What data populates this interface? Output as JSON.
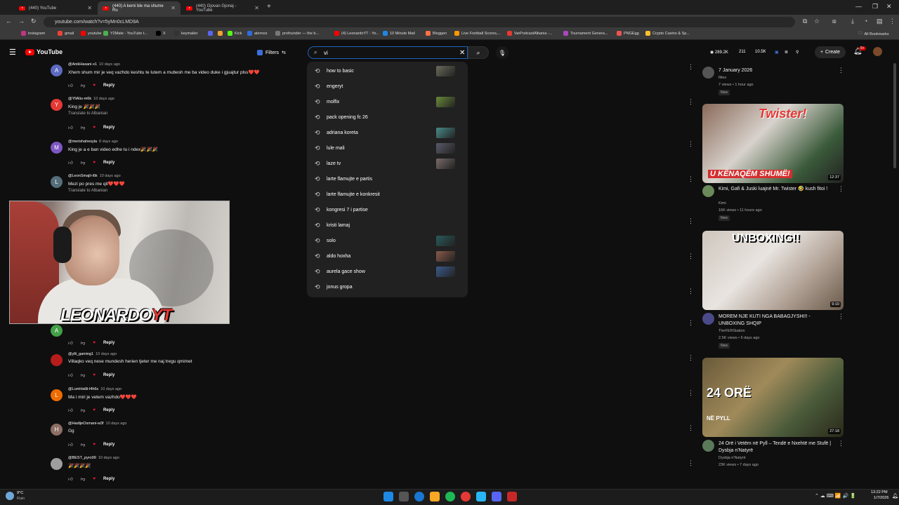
{
  "browser": {
    "tabs": [
      {
        "label": "(440) YouTube",
        "active": false
      },
      {
        "label": "(440) A kemi ble ma shume Ru",
        "active": true
      },
      {
        "label": "(440) Gjovan Gjonaj - YouTube",
        "active": false
      }
    ],
    "new_tab": "+",
    "url": "youtube.com/watch?v=5yMn0cLMD9A",
    "bookmarks": [
      "instagram",
      "gmail",
      "youtube",
      "Y2Mate - YouTube t...",
      "X",
      "keymailer",
      "",
      "",
      "Kick",
      "aternos",
      "profounder — the b...",
      "(4) LeonardoYT - Yo...",
      "10 Minute Mail",
      "Bloggen",
      "Live Football Scores,...",
      "VarPodcastAlbania -...",
      "Tournament Genera...",
      "PNGEgg",
      "Crypto Casino & Sp..."
    ],
    "all_bookmarks": "All Bookmarks"
  },
  "youtube": {
    "logo_text": "YouTube",
    "filters_label": "Filters",
    "search_value": "vi",
    "stats": [
      "289.2K",
      "211",
      "10.5K"
    ],
    "create_label": "Create",
    "notif_count": "9+"
  },
  "suggestions": [
    {
      "text": "how to basic",
      "thumb": "#6a6a5a"
    },
    {
      "text": "engeryt",
      "thumb": ""
    },
    {
      "text": "molfix",
      "thumb": "#6a8a3a"
    },
    {
      "text": "pack opening fc 26",
      "thumb": ""
    },
    {
      "text": "adriana koreta",
      "thumb": "#4a8a8a"
    },
    {
      "text": "lule mali",
      "thumb": "#5a5a6a"
    },
    {
      "text": "laze tv",
      "thumb": "#7a6a6a"
    },
    {
      "text": "larte flamujte e partis",
      "thumb": ""
    },
    {
      "text": "larte flamujte e konkresit",
      "thumb": ""
    },
    {
      "text": "kongresi 7 i partise",
      "thumb": ""
    },
    {
      "text": "kristi lamaj",
      "thumb": ""
    },
    {
      "text": "solo",
      "thumb": "#2a5a5a"
    },
    {
      "text": "aldo hoxha",
      "thumb": "#8a5a4a"
    },
    {
      "text": "aurela gace show",
      "thumb": "#3a5a8a"
    },
    {
      "text": "jonus gropa",
      "thumb": ""
    }
  ],
  "comments": [
    {
      "initial": "A",
      "color": "#5c6bc0",
      "user": "@AnikHasani-x1",
      "time": "10 days ago",
      "text": "Xhem shum mir je veq vazhdo keshtu te lutem a mubesh me ba video duke i gjuajtur plss❤️❤️",
      "translate": "",
      "reply": "Reply"
    },
    {
      "initial": "Y",
      "color": "#e53935",
      "user": "@YllAliu-m6k",
      "time": "10 days ago",
      "text": "King je 🎉🎉🎉",
      "translate": "Translate to Albanian",
      "reply": "Reply"
    },
    {
      "initial": "M",
      "color": "#7e57c2",
      "user": "@merishahesyla",
      "time": "8 days ago",
      "text": "King je a e ban video edhe tu i ndex🎉🎉🎉",
      "translate": "",
      "reply": "Reply"
    },
    {
      "initial": "L",
      "color": "#546e7a",
      "user": "@LeonSmajli-i6k",
      "time": "10 days ago",
      "text": "Mezi po pres me qit❤️❤️❤️",
      "translate": "Translate to Albanian",
      "reply": ""
    },
    {
      "initial": "A",
      "color": "#43a047",
      "user": "",
      "time": "",
      "text": "",
      "translate": "",
      "reply": "Reply"
    },
    {
      "initial": "",
      "color": "#b71c1c",
      "user": "@ylli_gaming1",
      "time": "10 days ago",
      "text": "Villaqko veq nese mundesh herien tjeter me naj tregu qmimet",
      "translate": "",
      "reply": "Reply"
    },
    {
      "initial": "L",
      "color": "#ef6c00",
      "user": "@LumHalili-l4h6s",
      "time": "10 days ago",
      "text": "Ma i miri je vetem vazhdo❤️❤️❤️",
      "translate": "",
      "reply": "Reply"
    },
    {
      "initial": "H",
      "color": "#8d6e63",
      "user": "@HadijeOsmani-w3f",
      "time": "10 days ago",
      "text": "Gg",
      "translate": "",
      "reply": "Reply"
    },
    {
      "initial": "",
      "color": "#9e9e9e",
      "user": "@BEST_pyro99",
      "time": "10 days ago",
      "text": "🎉🎉🎉🎉",
      "translate": "",
      "reply": "Reply"
    }
  ],
  "sidebar": [
    {
      "title": "7 January 2026",
      "channel": "fitlex",
      "meta": "7 views • 1 hour ago",
      "badge": "New",
      "duration": "",
      "thumb_text": ""
    },
    {
      "title": "Kimi, Gafi & Juski luajnë Mr. Twister 🤣 kush fitoi !",
      "channel": "Kimi",
      "meta": "16K views • 11 hours ago",
      "badge": "New",
      "duration": "12:37",
      "thumb_text": "Twister!",
      "thumb_sub": "U KËNAQËM SHUMË!"
    },
    {
      "title": "MOREM NJE KUTI NGA BABAGJYSHI!! - UNBOXING SHQIP",
      "channel": "TheFERStation",
      "meta": "2.5K views • 6 days ago",
      "badge": "New",
      "duration": "9:10",
      "thumb_text": "UNBOXING!!",
      "thumb_sub": ""
    },
    {
      "title": "24 Orë i Vetëm në Pyll – Tendë e Nxehtë me Stufë | Dysbja n'Natyrë",
      "channel": "Dysbja n'Natyrë",
      "meta": "23K views • 7 days ago",
      "badge": "",
      "duration": "27:18",
      "thumb_text": "24 ORË",
      "thumb_sub": "NË PYLL"
    }
  ],
  "webcam_logo": "LEONARDO",
  "webcam_logo_suffix": "YT",
  "taskbar": {
    "weather_temp": "9°C",
    "weather_desc": "Rain",
    "time": "13:22 PM",
    "date": "1/7/2026"
  }
}
